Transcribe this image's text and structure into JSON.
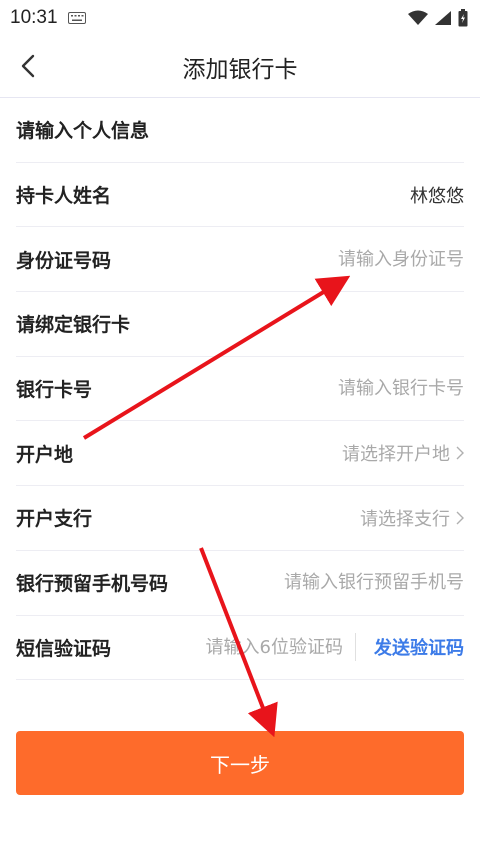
{
  "status_bar": {
    "time": "10:31"
  },
  "header": {
    "title": "添加银行卡"
  },
  "form": {
    "section_personal": "请输入个人信息",
    "holder_name_label": "持卡人姓名",
    "holder_name_value": "林悠悠",
    "id_number_label": "身份证号码",
    "id_number_placeholder": "请输入身份证号",
    "section_bind": "请绑定银行卡",
    "card_number_label": "银行卡号",
    "card_number_placeholder": "请输入银行卡号",
    "open_place_label": "开户地",
    "open_place_placeholder": "请选择开户地",
    "branch_label": "开户支行",
    "branch_placeholder": "请选择支行",
    "phone_label": "银行预留手机号码",
    "phone_placeholder": "请输入银行预留手机号",
    "sms_label": "短信验证码",
    "sms_placeholder": "请输入6位验证码",
    "send_code": "发送验证码"
  },
  "next_button": "下一步",
  "colors": {
    "accent": "#fe6b2b",
    "link": "#3c7be8",
    "annotation": "#e8141b"
  },
  "icons": [
    "keyboard-icon",
    "wifi-icon",
    "signal-icon",
    "battery-icon",
    "back-chevron-icon",
    "chevron-right-icon"
  ]
}
